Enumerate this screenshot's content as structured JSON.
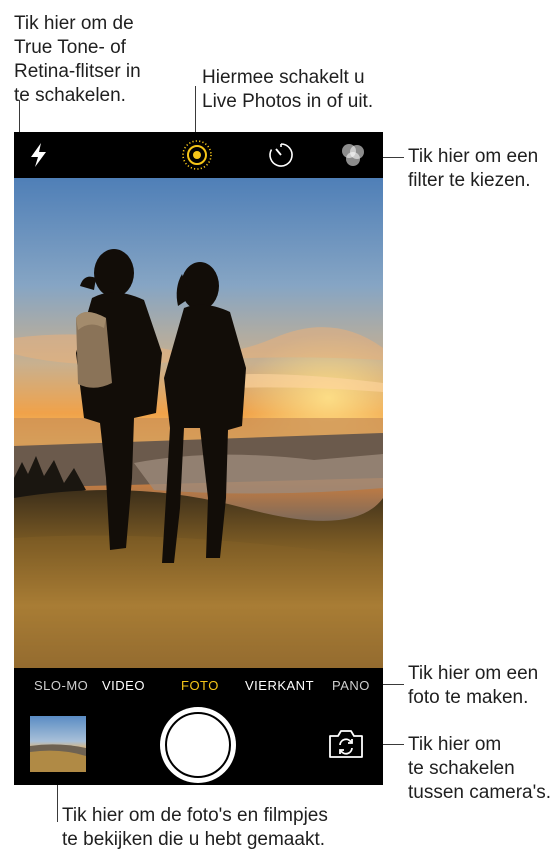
{
  "callouts": {
    "flash": "Tik hier om de\nTrue Tone- of\nRetina-flitser in\nte schakelen.",
    "live": "Hiermee schakelt u\nLive Photos in of uit.",
    "filter": "Tik hier om een\nfilter te kiezen.",
    "shutter": "Tik hier om een\nfoto te maken.",
    "switch": "Tik hier om\nte schakelen\ntussen camera's.",
    "thumbnail": "Tik hier om de foto's en filmpjes\nte bekijken die u hebt gemaakt."
  },
  "modes": {
    "slomo": "SLO-MO",
    "video": "VIDEO",
    "foto": "FOTO",
    "vierkant": "VIERKANT",
    "pano": "PANO"
  },
  "icons": {
    "flash": "flash-icon",
    "live": "live-photos-icon",
    "timer": "timer-icon",
    "filter": "filter-icon",
    "switch": "switch-camera-icon"
  },
  "colors": {
    "accent": "#f5c518",
    "background": "#000000"
  }
}
